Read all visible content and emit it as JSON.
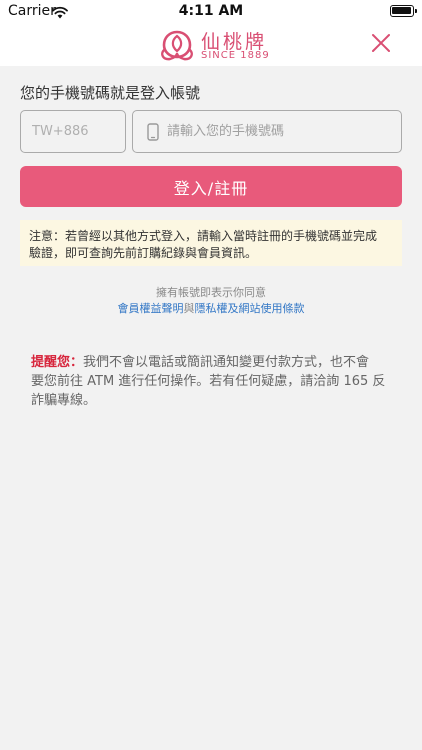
{
  "statusbar": {
    "carrier": "Carrier",
    "time": "4:11 AM"
  },
  "header": {
    "brand_name": "仙桃牌",
    "brand_sub": "SINCE 1889",
    "brand_color": "#d94f73"
  },
  "login": {
    "title": "您的手機號碼就是登入帳號",
    "country_placeholder": "TW+886",
    "country_value": "",
    "phone_placeholder": "請輸入您的手機號碼",
    "phone_value": "",
    "submit_label": "登入/註冊",
    "accent_color": "#e85a7b"
  },
  "notice": {
    "line1": "注意：若曾經以其他方式登入，請輸入當時註冊的手機號碼並完成",
    "line2": "驗證，即可查詢先前訂購紀錄與會員資訊。"
  },
  "consent": {
    "text": "擁有帳號即表示你同意",
    "link1": "會員權益聲明",
    "joiner": "與",
    "link2": "隱私權及網站使用條款"
  },
  "reminder": {
    "label": "提醒您：",
    "line1": "我們不會以電話或簡訊通知變更付款方式，也不會",
    "line2": "要您前往 ATM 進行任何操作。若有任何疑慮，請洽詢 165 反",
    "line3": "詐騙專線。",
    "label_color": "#d7263d"
  }
}
